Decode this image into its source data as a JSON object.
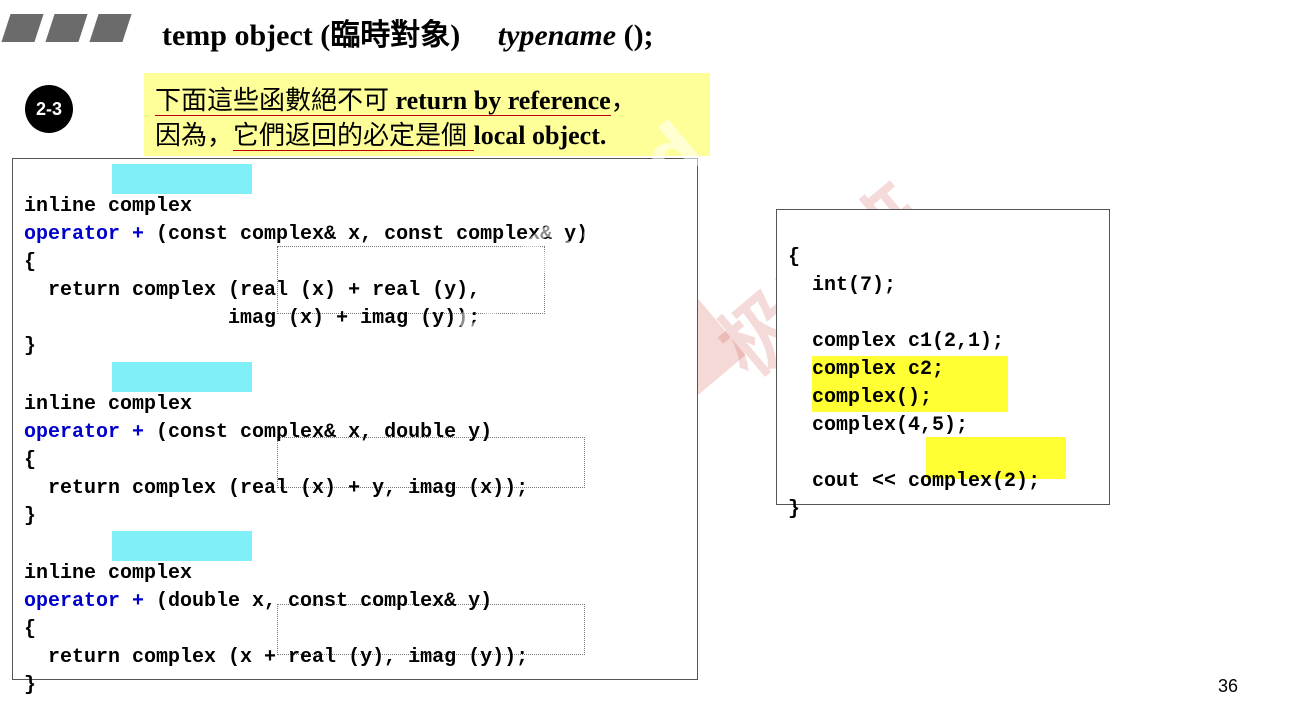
{
  "header": {
    "title_main": "temp object (臨時對象)",
    "title_code": "typename",
    "title_tail": " ();"
  },
  "badge": "2-3",
  "note": {
    "line1_zh": "下面這些函數絕不可 ",
    "line1_en": "return by reference",
    "line1_end": "，",
    "line2_zh_a": "因為，",
    "line2_zh_b": "它們返回的必定是個 ",
    "line2_en": "local object."
  },
  "left_code": {
    "block1": {
      "l1_kw": "inline ",
      "l1_type": "complex",
      "l2_op": "operator +",
      "l2_rest": " (const complex& x, const complex& y)",
      "l3": "{",
      "l4_a": "  return complex (",
      "l4_b": "real (x) + real (y)",
      "l4_c": ",",
      "l5_a": "                 ",
      "l5_b": "imag (x) + imag (y)",
      "l5_c": ");",
      "l6": "}"
    },
    "block2": {
      "l1_kw": "inline ",
      "l1_type": "complex",
      "l2_op": "operator +",
      "l2_rest": " (const complex& x, double y)",
      "l3": "{",
      "l4_a": "  return complex (",
      "l4_b": "real (x) + y, imag (x)",
      "l4_c": ");",
      "l5": "}"
    },
    "block3": {
      "l1_kw": "inline ",
      "l1_type": "complex",
      "l2_op": "operator +",
      "l2_rest": " (double x, const complex& y)",
      "l3": "{",
      "l4_a": "  return complex (",
      "l4_b": "x + real (y), imag (y)",
      "l4_c": ");",
      "l5": "}"
    }
  },
  "right_code": {
    "l1": "{",
    "l2": "  int(7);",
    "l4": "  complex c1(2,1);",
    "l5": "  complex c2;",
    "l6": "complex();",
    "l7": "complex(4,5);",
    "l9_a": "  cout << ",
    "l9_b": "complex(2)",
    "l9_c": ";",
    "l10": "}"
  },
  "watermark": {
    "text": "GeekBand",
    "cn": "极客班"
  },
  "page_number": "36"
}
